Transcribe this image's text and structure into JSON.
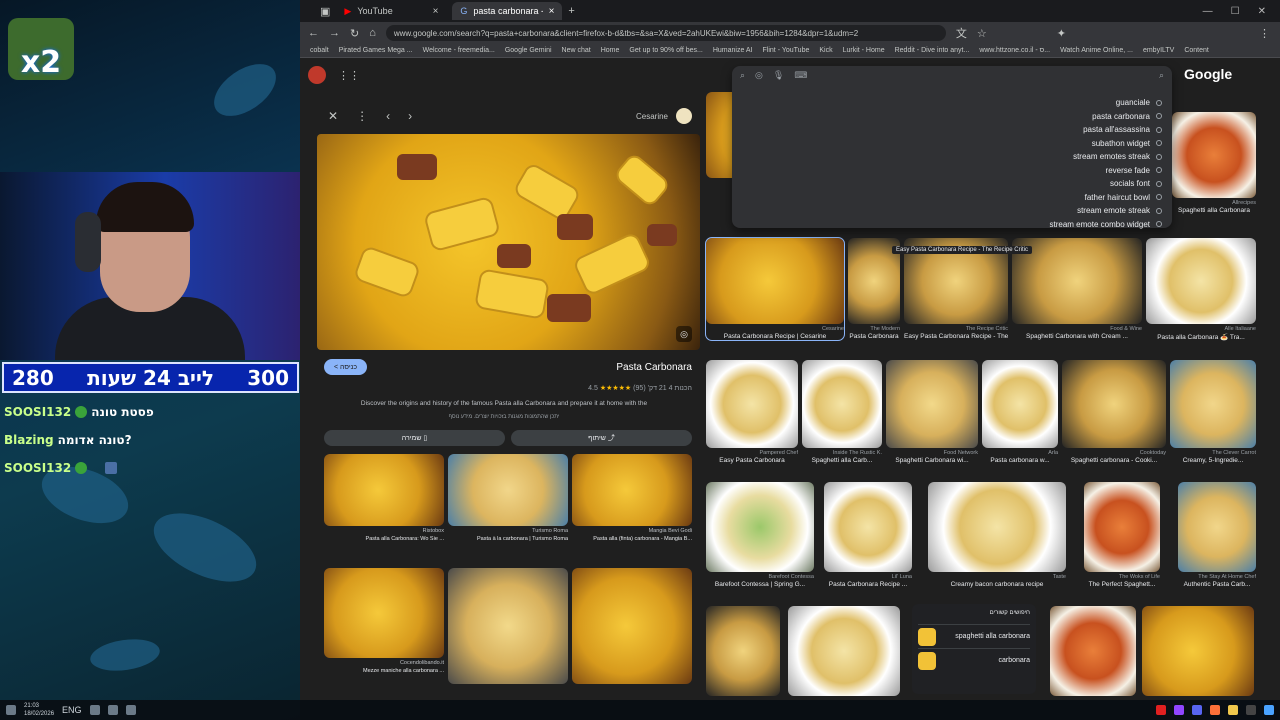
{
  "stream": {
    "badge_text": "x2",
    "score_left": "280",
    "score_title": "לייב 24 שעות",
    "score_right": "300",
    "chat": [
      {
        "user": "SOOSI132",
        "message": "פסטת טונה"
      },
      {
        "user": "Blazing",
        "message": "טונה אדומה?"
      },
      {
        "user": "SOOSI132",
        "message": ""
      }
    ]
  },
  "browser": {
    "tabs": [
      {
        "label": "YouTube"
      },
      {
        "label": "pasta carbonara - חיפוש ב"
      }
    ],
    "url": "www.google.com/search?q=pasta+carbonara&client=firefox-b-d&tbs=&sa=X&ved=2ahUKEwi&biw=1956&bih=1284&dpr=1&udm=2",
    "bookmarks": [
      "cobalt",
      "Pirated Games Mega ...",
      "Welcome - freemedia...",
      "Google Gemini",
      "New chat",
      "Home",
      "Get up to 90% off bes...",
      "Humanize AI",
      "Flint - YouTube",
      "Kick",
      "Lurkit - Home",
      "Reddit - Dive into anyt...",
      "www.httzone.co.il - ס...",
      "Watch Anime Online, ...",
      "embyILTV",
      "Content"
    ]
  },
  "google": {
    "logo": "Google",
    "suggestions": [
      "guanciale",
      "pasta carbonara",
      "pasta all'assassina",
      "subathon widget",
      "stream emotes streak",
      "reverse fade",
      "socials font",
      "father haircut bowl",
      "stream emote streak",
      "stream emote combo widget"
    ]
  },
  "preview": {
    "source": "Cesarine",
    "visit": "< כניסה",
    "title": "Pasta Carbonara",
    "rating_count": "(95)",
    "rating_stars": "★★★★★",
    "rating_value": "4.5",
    "time_text": "21 דק'",
    "prep_text": "הכנות 4",
    "description": "Discover the origins and history of the famous Pasta alla Carbonara and prepare it at home with the",
    "note": "יתכן שהתמונות מוגנות בזכויות יוצרים. מידע נוסף",
    "save": "שמירה",
    "share": "שיתוף",
    "related": [
      {
        "source": "Ristobox",
        "caption": "Pasta alla Carbonara: Wo Sie ..."
      },
      {
        "source": "Turismo Roma",
        "caption": "Pasta à la carbonara | Turismo Roma"
      },
      {
        "source": "Mangia Bevi Godi",
        "caption": "Pasta alla (finta) carbonara - Mangia B..."
      },
      {
        "source": "Cocendolibando.it",
        "caption": "Mezze maniche alla carbonara ..."
      },
      {
        "source": "",
        "caption": ""
      },
      {
        "source": "",
        "caption": ""
      }
    ]
  },
  "results": [
    {
      "source": "Cesarine",
      "caption": "Pasta Carbonara Recipe | Cesarine"
    },
    {
      "source": "The Modern",
      "caption": "Pasta Carbonara"
    },
    {
      "source": "The Recipe Critic",
      "caption": "Easy Pasta Carbonara Recipe - The Recipe Critic"
    },
    {
      "source": "Food & Wine",
      "caption": "Spaghetti Carbonara with Cream ..."
    },
    {
      "source": "Alle Italiaane",
      "caption": "Pasta alla Carbonara 🍝 Tra..."
    },
    {
      "source": "Pampered Chef",
      "caption": "Easy Pasta Carbonara"
    },
    {
      "source": "Inside The Rustic K.",
      "caption": "Spaghetti alla Carb..."
    },
    {
      "source": "Food Network",
      "caption": "Spaghetti Carbonara wi..."
    },
    {
      "source": "Arla",
      "caption": "Pasta carbonara w..."
    },
    {
      "source": "Cooktoday",
      "caption": "Spaghetti carbonara - Cooki..."
    },
    {
      "source": "The Clever Carrot",
      "caption": "Creamy, 5-Ingredie..."
    },
    {
      "source": "Barefoot Contessa",
      "caption": "Barefoot Contessa | Spring G..."
    },
    {
      "source": "Lil' Luna",
      "caption": "Pasta Carbonara Recipe ..."
    },
    {
      "source": "Taste",
      "caption": "Creamy bacon carbonara recipe"
    },
    {
      "source": "The Woks of Life",
      "caption": "The Perfect Spaghett..."
    },
    {
      "source": "The Stay At Home Chef",
      "caption": "Authentic Pasta Carb..."
    },
    {
      "source": "Allrecipes",
      "caption": "Spaghetti alla Carbonara"
    }
  ],
  "related_searches": {
    "title": "חיפושים קשורים",
    "items": [
      "spaghetti alla carbonara",
      "carbonara"
    ]
  },
  "taskbar": {
    "time": "21:03",
    "date": "18/02/2026",
    "lang": "ENG"
  }
}
